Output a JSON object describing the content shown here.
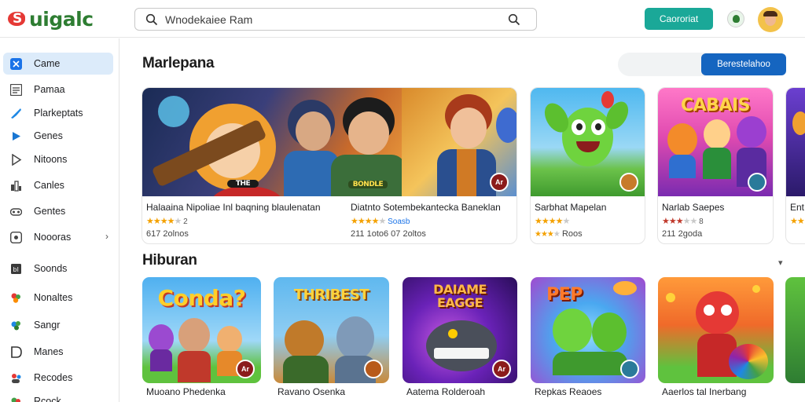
{
  "header": {
    "logo_text": "uigalc",
    "search_value": "Wnodekaiee Ram",
    "button_label": "Caororiat"
  },
  "sidebar": {
    "items": [
      {
        "label": "Came",
        "icon": "grid-icon",
        "active": true
      },
      {
        "label": "Pamaa",
        "icon": "list-icon"
      },
      {
        "label": "Plarkeptats",
        "icon": "paint-icon"
      },
      {
        "label": "Genes",
        "icon": "play-icon"
      },
      {
        "label": "Nitoons",
        "icon": "play-circle-icon"
      },
      {
        "label": "Canles",
        "icon": "bar-chart-icon"
      },
      {
        "label": "Gentes",
        "icon": "gamepad-icon"
      },
      {
        "label": "Noooras",
        "icon": "monitor-icon",
        "has_chevron": true
      },
      {
        "label": "Soonds",
        "icon": "square-icon"
      },
      {
        "label": "Nonaltes",
        "icon": "flower-icon"
      },
      {
        "label": "Sangr",
        "icon": "leaf-icon"
      },
      {
        "label": "Manes",
        "icon": "d-icon"
      },
      {
        "label": "Recodes",
        "icon": "people-icon"
      },
      {
        "label": "Rcock",
        "icon": "leaf-icon"
      }
    ]
  },
  "main": {
    "section1_title": "Marlepana",
    "section1_button": "Berestelahoo",
    "section2_title": "Hiburan",
    "featured": [
      {
        "title": "Halaaina Nipoliae Inl baqning blaulenatan",
        "rating_text": "★★★★ 2",
        "stars": 4,
        "meta": "617  2olnos"
      },
      {
        "title": "Diatnto Sotembekantecka Baneklan",
        "stars": 4,
        "rating_text": "Soasb",
        "meta": "211  1oto6  07  2oltos"
      },
      {
        "title": "Sarbhat Mapelan",
        "stars": 4,
        "rating_text": "",
        "meta": "Roos"
      },
      {
        "title": "Narlab Saepes",
        "stars": 3,
        "rating_text": "8",
        "meta": "211  2goda"
      },
      {
        "title": "Ent",
        "stars": 2,
        "rating_text": "",
        "meta": ""
      }
    ],
    "featured_art_labels": [
      "THE",
      "BONDLE",
      "CABAIS",
      "Ar"
    ],
    "entertainment": [
      {
        "title": "Muoano Phedenka",
        "art_label": "Conda?"
      },
      {
        "title": "Ravano Osenka",
        "art_label": "THRIBEST"
      },
      {
        "title": "Aatema Rolderoah",
        "art_label": "DAIAME EAGGE"
      },
      {
        "title": "Repkas Reaoes",
        "art_label": "PEP"
      },
      {
        "title": "Aaerlos tal Inerbang",
        "art_label": ""
      }
    ],
    "badge_text": "Ar"
  }
}
